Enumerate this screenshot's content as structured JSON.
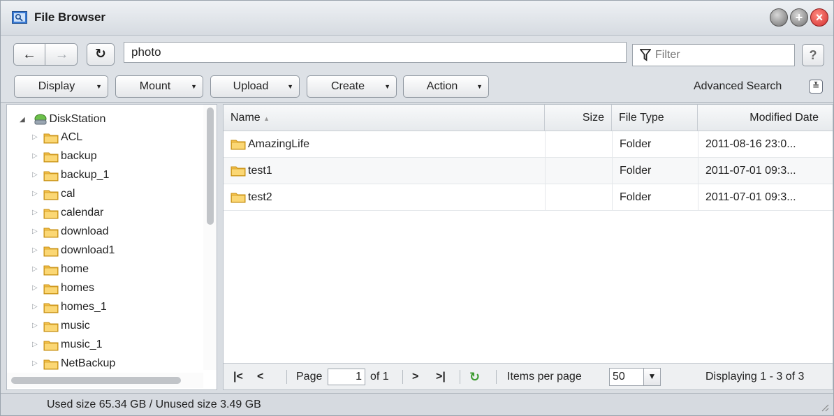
{
  "window": {
    "title": "File Browser",
    "title_icon": "file-browser-icon"
  },
  "address": {
    "back_icon": "arrow-left-icon",
    "forward_icon": "arrow-right-icon",
    "refresh_icon": "refresh-icon",
    "path": "photo",
    "filter_placeholder": "Filter",
    "help_label": "?"
  },
  "toolbar": {
    "display_label": "Display",
    "mount_label": "Mount",
    "upload_label": "Upload",
    "create_label": "Create",
    "action_label": "Action",
    "advanced_search_label": "Advanced Search"
  },
  "tree": {
    "root_label": "DiskStation",
    "items": [
      {
        "label": "ACL"
      },
      {
        "label": "backup"
      },
      {
        "label": "backup_1"
      },
      {
        "label": "cal"
      },
      {
        "label": "calendar"
      },
      {
        "label": "download"
      },
      {
        "label": "download1"
      },
      {
        "label": "home"
      },
      {
        "label": "homes"
      },
      {
        "label": "homes_1"
      },
      {
        "label": "music"
      },
      {
        "label": "music_1"
      },
      {
        "label": "NetBackup"
      }
    ]
  },
  "grid": {
    "columns": {
      "name": "Name",
      "size": "Size",
      "type": "File Type",
      "date": "Modified Date"
    },
    "rows": [
      {
        "name": "AmazingLife",
        "size": "",
        "type": "Folder",
        "date": "2011-08-16 23:0..."
      },
      {
        "name": "test1",
        "size": "",
        "type": "Folder",
        "date": "2011-07-01 09:3..."
      },
      {
        "name": "test2",
        "size": "",
        "type": "Folder",
        "date": "2011-07-01 09:3..."
      }
    ]
  },
  "paging": {
    "page_label": "Page",
    "page_value": "1",
    "of_label": "of 1",
    "items_per_page_label": "Items per page",
    "items_per_page_value": "50",
    "displaying": "Displaying 1 - 3 of 3"
  },
  "status": {
    "text": "Used size 65.34 GB / Unused size 3.49 GB"
  },
  "colors": {
    "accent": "#2f6fb7",
    "folder": "#f4c04a",
    "close": "#d32f2f"
  }
}
